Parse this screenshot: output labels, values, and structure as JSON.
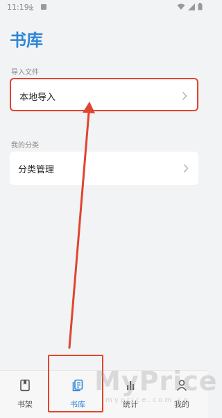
{
  "status_bar": {
    "time": "11:19"
  },
  "header": {
    "title": "书库"
  },
  "import_section": {
    "label": "导入文件",
    "local_import_label": "本地导入"
  },
  "category_section": {
    "label": "我的分类",
    "manage_label": "分类管理"
  },
  "tab_bar": {
    "tabs": [
      {
        "label": "书架",
        "icon": "bookshelf-icon"
      },
      {
        "label": "书库",
        "icon": "library-icon",
        "active": true
      },
      {
        "label": "统计",
        "icon": "bar-chart-icon"
      },
      {
        "label": "我的",
        "icon": "person-icon"
      }
    ]
  },
  "watermark": {
    "text": "MyPrice",
    "sub": "myprice.com.cn"
  },
  "colors": {
    "accent": "#2f86d6",
    "annotation": "#e0452f",
    "background": "#f2f3f5"
  }
}
